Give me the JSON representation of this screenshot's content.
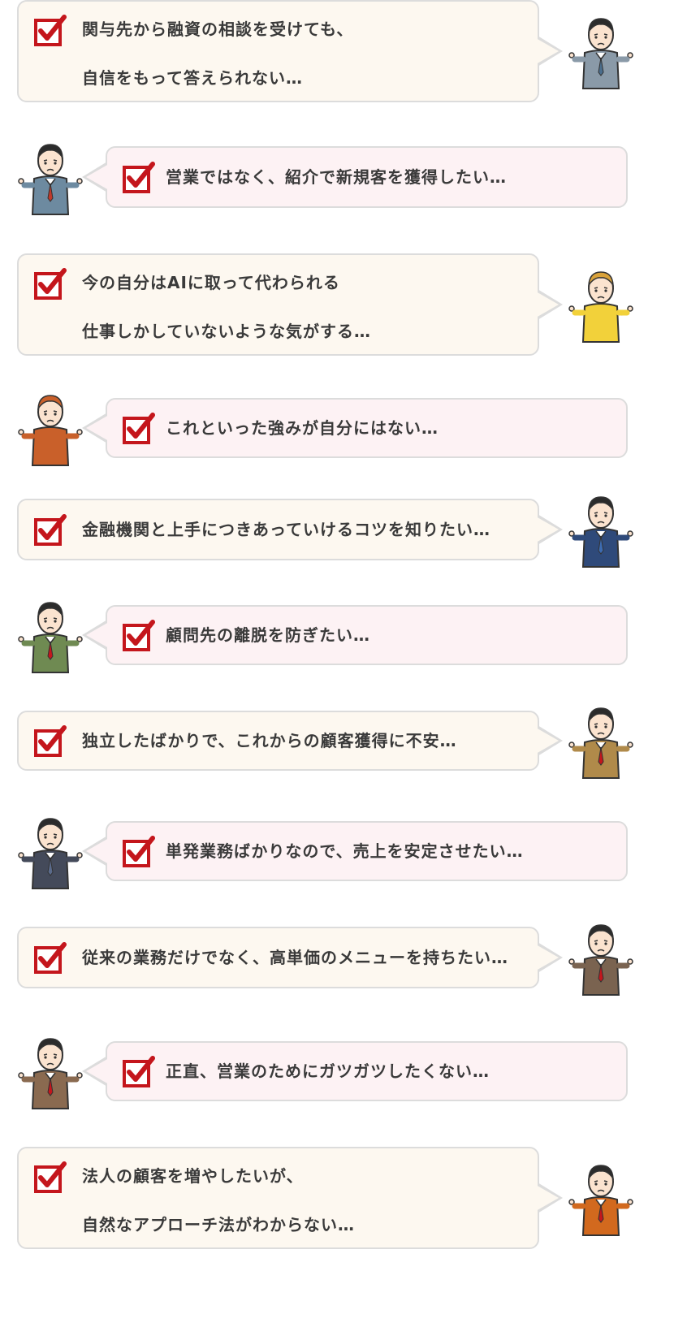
{
  "colors": {
    "check": "#c4161c",
    "bubble_cream": "#fdf8f0",
    "bubble_pink": "#fdf2f4",
    "border": "#dcdcdc"
  },
  "items": [
    {
      "lines": [
        "関与先から融資の相談を受けても、",
        "自信をもって答えられない…"
      ],
      "icon": "worried-businessman-glasses-icon"
    },
    {
      "lines": [
        "営業ではなく、紹介で新規客を獲得したい…"
      ],
      "icon": "worried-businessman-icon"
    },
    {
      "lines": [
        "今の自分はAIに取って代わられる",
        "仕事しかしていないような気がする…"
      ],
      "icon": "worried-businesswoman-icon"
    },
    {
      "lines": [
        "これといった強みが自分にはない…"
      ],
      "icon": "worried-businesswoman-glasses-icon"
    },
    {
      "lines": [
        "金融機関と上手につきあっていけるコツを知りたい…"
      ],
      "icon": "worried-businessman-icon"
    },
    {
      "lines": [
        "顧問先の離脱を防ぎたい…"
      ],
      "icon": "worried-businessman-icon"
    },
    {
      "lines": [
        "独立したばかりで、これからの顧客獲得に不安…"
      ],
      "icon": "worried-businessman-icon"
    },
    {
      "lines": [
        "単発業務ばかりなので、売上を安定させたい…"
      ],
      "icon": "worried-businessman-icon"
    },
    {
      "lines": [
        "従来の業務だけでなく、高単価のメニューを持ちたい…"
      ],
      "icon": "worried-businessman-icon"
    },
    {
      "lines": [
        "正直、営業のためにガツガツしたくない…"
      ],
      "icon": "worried-elderly-man-glasses-icon"
    },
    {
      "lines": [
        "法人の顧客を増やしたいが、",
        "自然なアプローチ法がわからない…"
      ],
      "icon": "worried-elderly-man-glasses-icon"
    }
  ]
}
